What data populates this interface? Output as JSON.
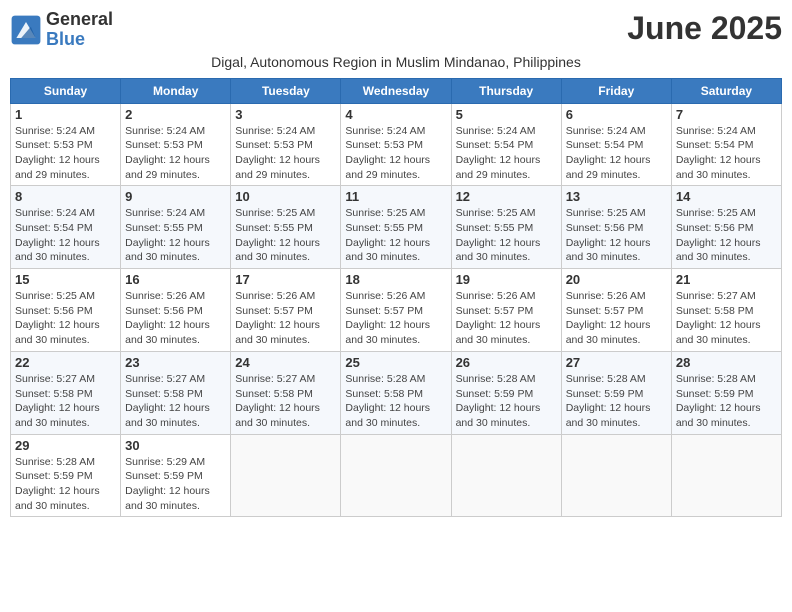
{
  "header": {
    "logo_line1": "General",
    "logo_line2": "Blue",
    "month_title": "June 2025",
    "subtitle": "Digal, Autonomous Region in Muslim Mindanao, Philippines"
  },
  "weekdays": [
    "Sunday",
    "Monday",
    "Tuesday",
    "Wednesday",
    "Thursday",
    "Friday",
    "Saturday"
  ],
  "weeks": [
    [
      {
        "day": "1",
        "sunrise": "Sunrise: 5:24 AM",
        "sunset": "Sunset: 5:53 PM",
        "daylight": "Daylight: 12 hours and 29 minutes."
      },
      {
        "day": "2",
        "sunrise": "Sunrise: 5:24 AM",
        "sunset": "Sunset: 5:53 PM",
        "daylight": "Daylight: 12 hours and 29 minutes."
      },
      {
        "day": "3",
        "sunrise": "Sunrise: 5:24 AM",
        "sunset": "Sunset: 5:53 PM",
        "daylight": "Daylight: 12 hours and 29 minutes."
      },
      {
        "day": "4",
        "sunrise": "Sunrise: 5:24 AM",
        "sunset": "Sunset: 5:53 PM",
        "daylight": "Daylight: 12 hours and 29 minutes."
      },
      {
        "day": "5",
        "sunrise": "Sunrise: 5:24 AM",
        "sunset": "Sunset: 5:54 PM",
        "daylight": "Daylight: 12 hours and 29 minutes."
      },
      {
        "day": "6",
        "sunrise": "Sunrise: 5:24 AM",
        "sunset": "Sunset: 5:54 PM",
        "daylight": "Daylight: 12 hours and 29 minutes."
      },
      {
        "day": "7",
        "sunrise": "Sunrise: 5:24 AM",
        "sunset": "Sunset: 5:54 PM",
        "daylight": "Daylight: 12 hours and 30 minutes."
      }
    ],
    [
      {
        "day": "8",
        "sunrise": "Sunrise: 5:24 AM",
        "sunset": "Sunset: 5:54 PM",
        "daylight": "Daylight: 12 hours and 30 minutes."
      },
      {
        "day": "9",
        "sunrise": "Sunrise: 5:24 AM",
        "sunset": "Sunset: 5:55 PM",
        "daylight": "Daylight: 12 hours and 30 minutes."
      },
      {
        "day": "10",
        "sunrise": "Sunrise: 5:25 AM",
        "sunset": "Sunset: 5:55 PM",
        "daylight": "Daylight: 12 hours and 30 minutes."
      },
      {
        "day": "11",
        "sunrise": "Sunrise: 5:25 AM",
        "sunset": "Sunset: 5:55 PM",
        "daylight": "Daylight: 12 hours and 30 minutes."
      },
      {
        "day": "12",
        "sunrise": "Sunrise: 5:25 AM",
        "sunset": "Sunset: 5:55 PM",
        "daylight": "Daylight: 12 hours and 30 minutes."
      },
      {
        "day": "13",
        "sunrise": "Sunrise: 5:25 AM",
        "sunset": "Sunset: 5:56 PM",
        "daylight": "Daylight: 12 hours and 30 minutes."
      },
      {
        "day": "14",
        "sunrise": "Sunrise: 5:25 AM",
        "sunset": "Sunset: 5:56 PM",
        "daylight": "Daylight: 12 hours and 30 minutes."
      }
    ],
    [
      {
        "day": "15",
        "sunrise": "Sunrise: 5:25 AM",
        "sunset": "Sunset: 5:56 PM",
        "daylight": "Daylight: 12 hours and 30 minutes."
      },
      {
        "day": "16",
        "sunrise": "Sunrise: 5:26 AM",
        "sunset": "Sunset: 5:56 PM",
        "daylight": "Daylight: 12 hours and 30 minutes."
      },
      {
        "day": "17",
        "sunrise": "Sunrise: 5:26 AM",
        "sunset": "Sunset: 5:57 PM",
        "daylight": "Daylight: 12 hours and 30 minutes."
      },
      {
        "day": "18",
        "sunrise": "Sunrise: 5:26 AM",
        "sunset": "Sunset: 5:57 PM",
        "daylight": "Daylight: 12 hours and 30 minutes."
      },
      {
        "day": "19",
        "sunrise": "Sunrise: 5:26 AM",
        "sunset": "Sunset: 5:57 PM",
        "daylight": "Daylight: 12 hours and 30 minutes."
      },
      {
        "day": "20",
        "sunrise": "Sunrise: 5:26 AM",
        "sunset": "Sunset: 5:57 PM",
        "daylight": "Daylight: 12 hours and 30 minutes."
      },
      {
        "day": "21",
        "sunrise": "Sunrise: 5:27 AM",
        "sunset": "Sunset: 5:58 PM",
        "daylight": "Daylight: 12 hours and 30 minutes."
      }
    ],
    [
      {
        "day": "22",
        "sunrise": "Sunrise: 5:27 AM",
        "sunset": "Sunset: 5:58 PM",
        "daylight": "Daylight: 12 hours and 30 minutes."
      },
      {
        "day": "23",
        "sunrise": "Sunrise: 5:27 AM",
        "sunset": "Sunset: 5:58 PM",
        "daylight": "Daylight: 12 hours and 30 minutes."
      },
      {
        "day": "24",
        "sunrise": "Sunrise: 5:27 AM",
        "sunset": "Sunset: 5:58 PM",
        "daylight": "Daylight: 12 hours and 30 minutes."
      },
      {
        "day": "25",
        "sunrise": "Sunrise: 5:28 AM",
        "sunset": "Sunset: 5:58 PM",
        "daylight": "Daylight: 12 hours and 30 minutes."
      },
      {
        "day": "26",
        "sunrise": "Sunrise: 5:28 AM",
        "sunset": "Sunset: 5:59 PM",
        "daylight": "Daylight: 12 hours and 30 minutes."
      },
      {
        "day": "27",
        "sunrise": "Sunrise: 5:28 AM",
        "sunset": "Sunset: 5:59 PM",
        "daylight": "Daylight: 12 hours and 30 minutes."
      },
      {
        "day": "28",
        "sunrise": "Sunrise: 5:28 AM",
        "sunset": "Sunset: 5:59 PM",
        "daylight": "Daylight: 12 hours and 30 minutes."
      }
    ],
    [
      {
        "day": "29",
        "sunrise": "Sunrise: 5:28 AM",
        "sunset": "Sunset: 5:59 PM",
        "daylight": "Daylight: 12 hours and 30 minutes."
      },
      {
        "day": "30",
        "sunrise": "Sunrise: 5:29 AM",
        "sunset": "Sunset: 5:59 PM",
        "daylight": "Daylight: 12 hours and 30 minutes."
      },
      null,
      null,
      null,
      null,
      null
    ]
  ]
}
